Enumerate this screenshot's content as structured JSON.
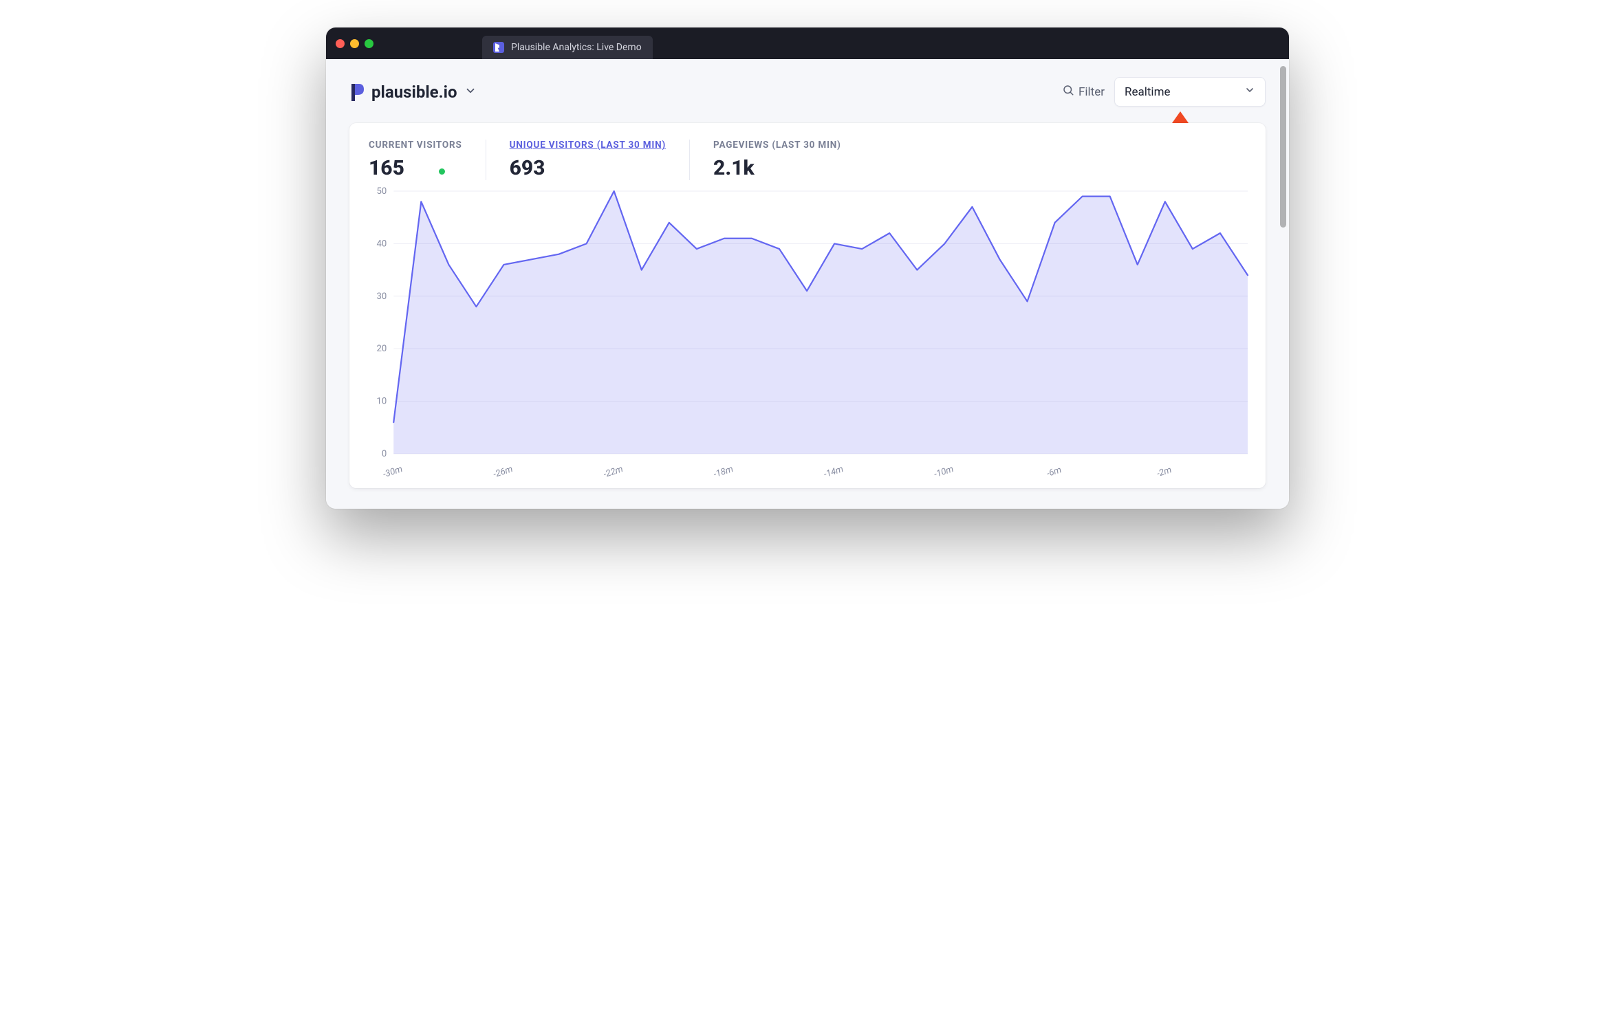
{
  "window": {
    "tab_title": "Plausible Analytics: Live Demo"
  },
  "header": {
    "site": "plausible.io",
    "filter_label": "Filter",
    "range_label": "Realtime"
  },
  "stats": {
    "current_visitors": {
      "label": "CURRENT VISITORS",
      "value": "165"
    },
    "unique_visitors": {
      "label": "UNIQUE VISITORS (LAST 30 MIN)",
      "value": "693"
    },
    "pageviews": {
      "label": "PAGEVIEWS (LAST 30 MIN)",
      "value": "2.1k"
    }
  },
  "chart_data": {
    "type": "area",
    "title": "",
    "xlabel": "",
    "ylabel": "",
    "ylim": [
      0,
      50
    ],
    "y_ticks": [
      0,
      10,
      20,
      30,
      40,
      50
    ],
    "x_tick_labels": [
      "-30m",
      "-26m",
      "-22m",
      "-18m",
      "-14m",
      "-10m",
      "-6m",
      "-2m"
    ],
    "x": [
      "-30m",
      "-29m",
      "-28m",
      "-27m",
      "-26m",
      "-25m",
      "-24m",
      "-23m",
      "-22m",
      "-21m",
      "-20m",
      "-19m",
      "-18m",
      "-17m",
      "-16m",
      "-15m",
      "-14m",
      "-13m",
      "-12m",
      "-11m",
      "-10m",
      "-9m",
      "-8m",
      "-7m",
      "-6m",
      "-5m",
      "-4m",
      "-3m",
      "-2m",
      "-1m"
    ],
    "values": [
      6,
      48,
      36,
      28,
      36,
      37,
      38,
      40,
      50,
      35,
      44,
      39,
      41,
      41,
      39,
      31,
      40,
      39,
      42,
      35,
      40,
      47,
      37,
      29,
      44,
      49,
      49,
      36,
      48,
      39,
      42,
      34
    ]
  }
}
